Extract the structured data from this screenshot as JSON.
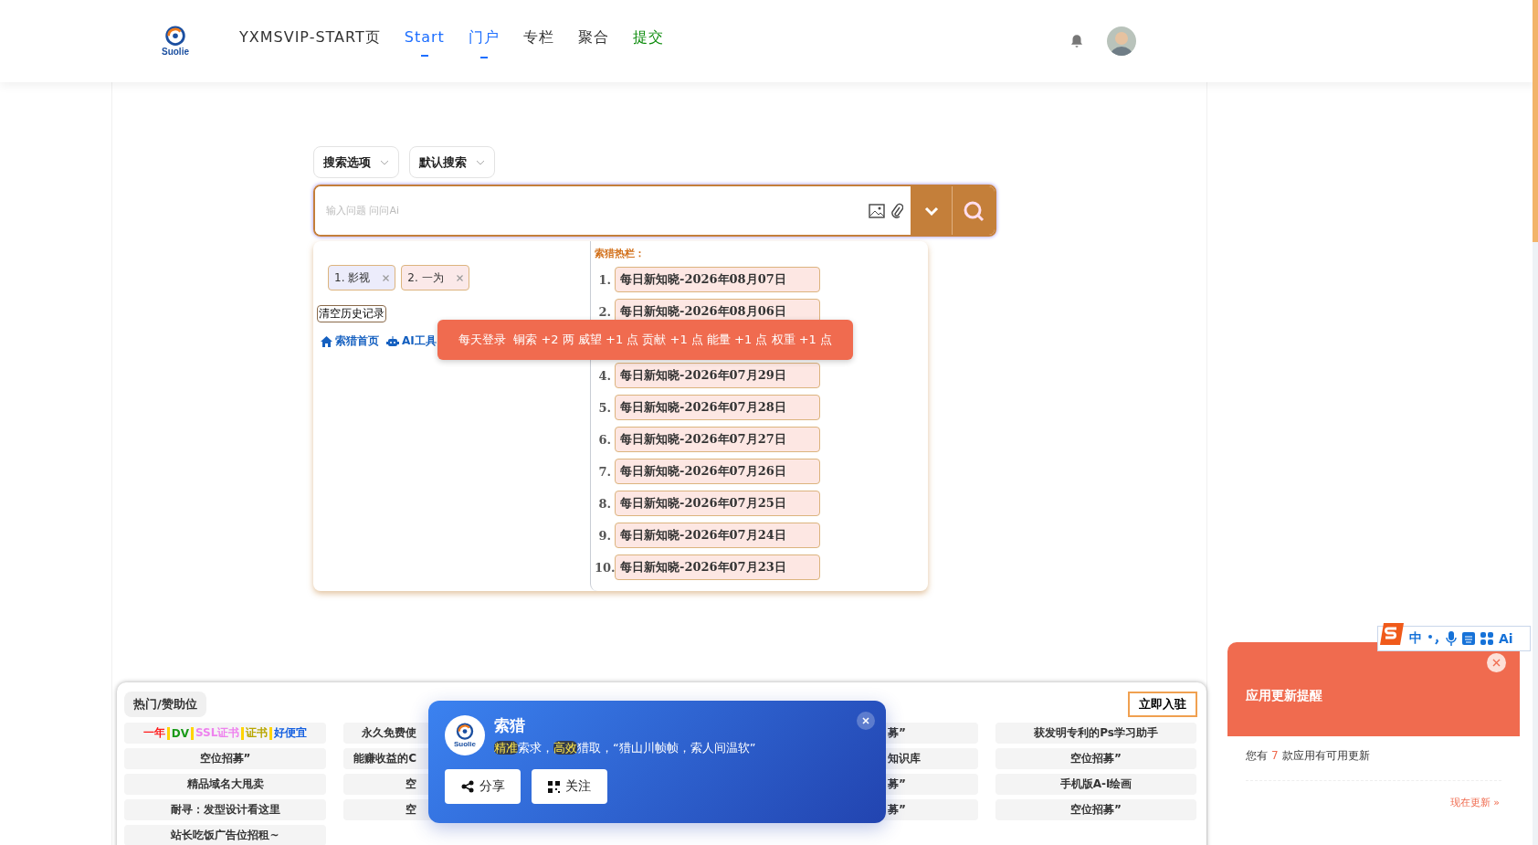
{
  "header": {
    "logo": "Suolie",
    "nav": [
      {
        "label": "YXMSVIP-START页",
        "selected": false,
        "color": "#333333"
      },
      {
        "label": "Start",
        "selected": true,
        "color": "#1e6fff"
      },
      {
        "label": "门户",
        "selected": true,
        "color": "#1e6fff"
      },
      {
        "label": "专栏",
        "selected": false,
        "color": "#333333"
      },
      {
        "label": "聚合",
        "selected": false,
        "color": "#333333"
      },
      {
        "label": "提交",
        "selected": false,
        "color": "#0a8a0a"
      }
    ]
  },
  "search": {
    "options": [
      "搜索选项",
      "默认搜索"
    ],
    "placeholder": "输入问题 问问Ai"
  },
  "history": {
    "tags": [
      {
        "label": "1. 影视",
        "color": "#ececfb"
      },
      {
        "label": "2. 一为",
        "color": "#fbe9e9"
      }
    ],
    "clear_label": "清空历史记录",
    "links": [
      {
        "kind": "home",
        "label": "索猎首页"
      },
      {
        "kind": "robot",
        "label": "AI工具"
      }
    ]
  },
  "hot": {
    "title": "索猎热栏：",
    "items": [
      {
        "number": "1.",
        "label": "每日新知晓-2026年08月07日"
      },
      {
        "number": "2.",
        "label": "每日新知晓-2026年08月06日"
      },
      {
        "number": "4.",
        "label": "每日新知晓-2026年07月29日"
      },
      {
        "number": "5.",
        "label": "每日新知晓-2026年07月28日"
      },
      {
        "number": "6.",
        "label": "每日新知晓-2026年07月27日"
      },
      {
        "number": "7.",
        "label": "每日新知晓-2026年07月26日"
      },
      {
        "number": "8.",
        "label": "每日新知晓-2026年07月25日"
      },
      {
        "number": "9.",
        "label": "每日新知晓-2026年07月24日"
      },
      {
        "number": "10.",
        "label": "每日新知晓-2026年07月23日"
      }
    ]
  },
  "toast": "每天登录  铜索 +2 两 威望 +1 点 贡献 +1 点 能量 +1 点 权重 +1 点",
  "sponsor": {
    "tab": "热门/赞助位",
    "join_button": "立即入驻",
    "columns": [
      {
        "kind": "full",
        "cells": [
          {
            "segments": [
              {
                "text": "一年",
                "color": "#ff1a1a"
              },
              {
                "text": "DV",
                "color": "#1a9a1a"
              },
              {
                "text": "SSL证书",
                "color": "#ee82ee"
              },
              {
                "text": "证书",
                "color": "#b8a600"
              },
              {
                "text": "好便宜",
                "color": "#1560e0"
              }
            ]
          },
          {
            "text": "空位招募”"
          },
          {
            "text": "精品域名大甩卖"
          },
          {
            "text": "耐寻：发型设计看这里"
          },
          {
            "text": "站长吃饭广告位招租~"
          }
        ]
      },
      {
        "kind": "cut-right",
        "cells": [
          {
            "text": "永久免费使"
          },
          {
            "text": "能赚收益的C"
          },
          {
            "text": "空"
          },
          {
            "text": "空"
          }
        ]
      },
      {
        "kind": "cut-left",
        "cells": [
          {
            "text": "募”"
          },
          {
            "text": "知识库"
          },
          {
            "text": "募”"
          },
          {
            "text": "募”"
          }
        ]
      },
      {
        "kind": "full",
        "cells": [
          {
            "text": "获发明专利的Ps学习助手"
          },
          {
            "text": "空位招募”"
          },
          {
            "text": "手机版A-I绘画"
          },
          {
            "text": "空位招募”"
          }
        ]
      }
    ]
  },
  "popup": {
    "logo": "Suolie",
    "title": "索猎",
    "description": "**精准**索求，**高效**猎取，“猎山川帧帧，索人间温软”",
    "buttons": [
      {
        "kind": "share",
        "label": "分享"
      },
      {
        "kind": "qr",
        "label": "关注"
      }
    ]
  },
  "notice": {
    "title": "应用更新提醒",
    "message_before": "您有",
    "count": "7",
    "message_after": "款应用有可用更新",
    "link": "现在更新 »"
  },
  "ime": {
    "mode": "中",
    "ai": "Ai"
  }
}
